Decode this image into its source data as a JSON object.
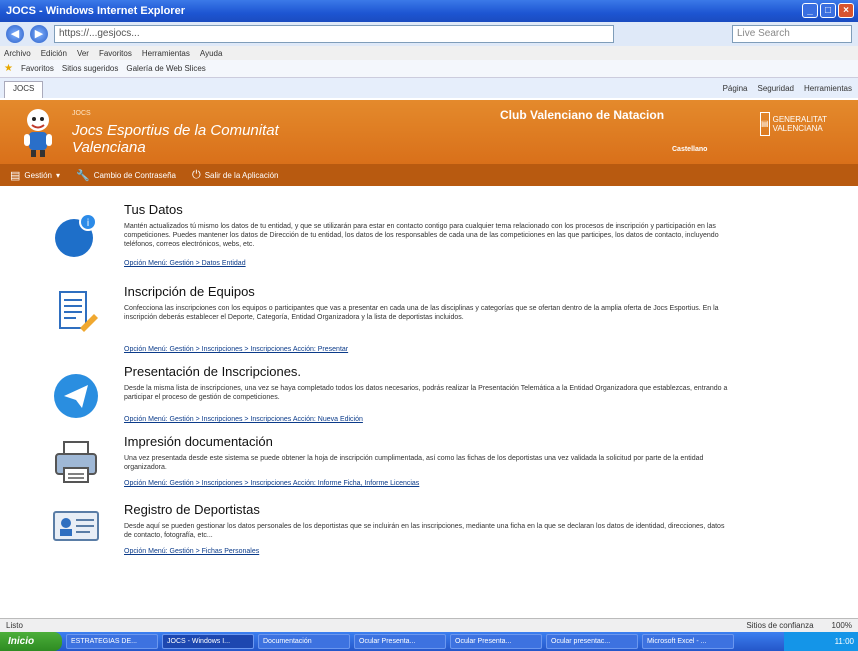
{
  "window": {
    "title": "JOCS - Windows Internet Explorer"
  },
  "address": {
    "url": "https://...gesjocs...",
    "search_placeholder": "Live Search"
  },
  "menubar": [
    "Archivo",
    "Edición",
    "Ver",
    "Favoritos",
    "Herramientas",
    "Ayuda"
  ],
  "favorites": {
    "label": "Favoritos",
    "item1": "Sitios sugeridos",
    "item2": "Galería de Web Slices"
  },
  "tabbar": {
    "tab_label": "JOCS",
    "commands": [
      "Página",
      "Seguridad",
      "Herramientas"
    ]
  },
  "site": {
    "small_title": "JOCS",
    "title": "Jocs Esportius de la Comunitat Valenciana",
    "club": "Club Valenciano de Natacion",
    "gva": "GENERALITAT VALENCIANA",
    "right_bold": "Castellano"
  },
  "nav": {
    "gestion": "Gestión",
    "cambio": "Cambio de Contraseña",
    "salir": "Salir de la Aplicación"
  },
  "sections": [
    {
      "title": "Tus Datos",
      "desc": "Mantén actualizados tú mismo los datos de tu entidad, y que se utilizarán para estar en contacto contigo para cualquier tema relacionado con los procesos de inscripción y participación en las competiciones. Puedes mantener los datos de Dirección de tu entidad, los datos de los responsables de cada una de las competiciones en las que participes, los datos de contacto, incluyendo teléfonos, correos electrónicos, webs, etc.",
      "link": "Opción Menú: Gestión > Datos Entidad"
    },
    {
      "title": "Inscripción de Equipos",
      "desc": "Confecciona las inscripciones con los equipos o participantes que vas a presentar en cada una de las disciplinas y categorías que se ofertan dentro de la amplia oferta de Jocs Esportius. En la inscripción deberás establecer el Deporte, Categoría, Entidad Organizadora y la lista de deportistas incluidos.",
      "link": "Opción Menú: Gestión > Inscripciones > Inscripciones Acción: Presentar"
    },
    {
      "title": "Presentación de Inscripciones.",
      "desc": "Desde la misma lista de inscripciones, una vez se haya completado todos los datos necesarios, podrás realizar la Presentación Telemática a la Entidad Organizadora que establezcas, entrando a participar el proceso de gestión de competiciones.",
      "link": "Opción Menú: Gestión > Inscripciones > Inscripciones Acción: Nueva Edición"
    },
    {
      "title": "Impresión documentación",
      "desc": "Una vez presentada desde este sistema se puede obtener la hoja de inscripción cumplimentada, así como las fichas de los deportistas una vez validada la solicitud por parte de la entidad organizadora.",
      "link": "Opción Menú: Gestión > Inscripciones > Inscripciones Acción: Informe Ficha, Informe Licencias"
    },
    {
      "title": "Registro de Deportistas",
      "desc": "Desde aquí se pueden gestionar los datos personales de los deportistas que se incluirán en las inscripciones, mediante una ficha en la que se declaran los datos de identidad, direcciones, datos de contacto, fotografía, etc...",
      "link": "Opción Menú: Gestión > Fichas Personales"
    }
  ],
  "status": {
    "left": "Listo",
    "zone": "Sitios de confianza",
    "zoom": "100%"
  },
  "taskbar": {
    "start": "Inicio",
    "items": [
      "ESTRATEGIAS DE...",
      "JOCS - Windows I...",
      "Documentación",
      "Ocular Presenta...",
      "Ocular Presenta...",
      "Ocular presentac...",
      "Microsoft Excel - ..."
    ],
    "clock": "11:00"
  }
}
